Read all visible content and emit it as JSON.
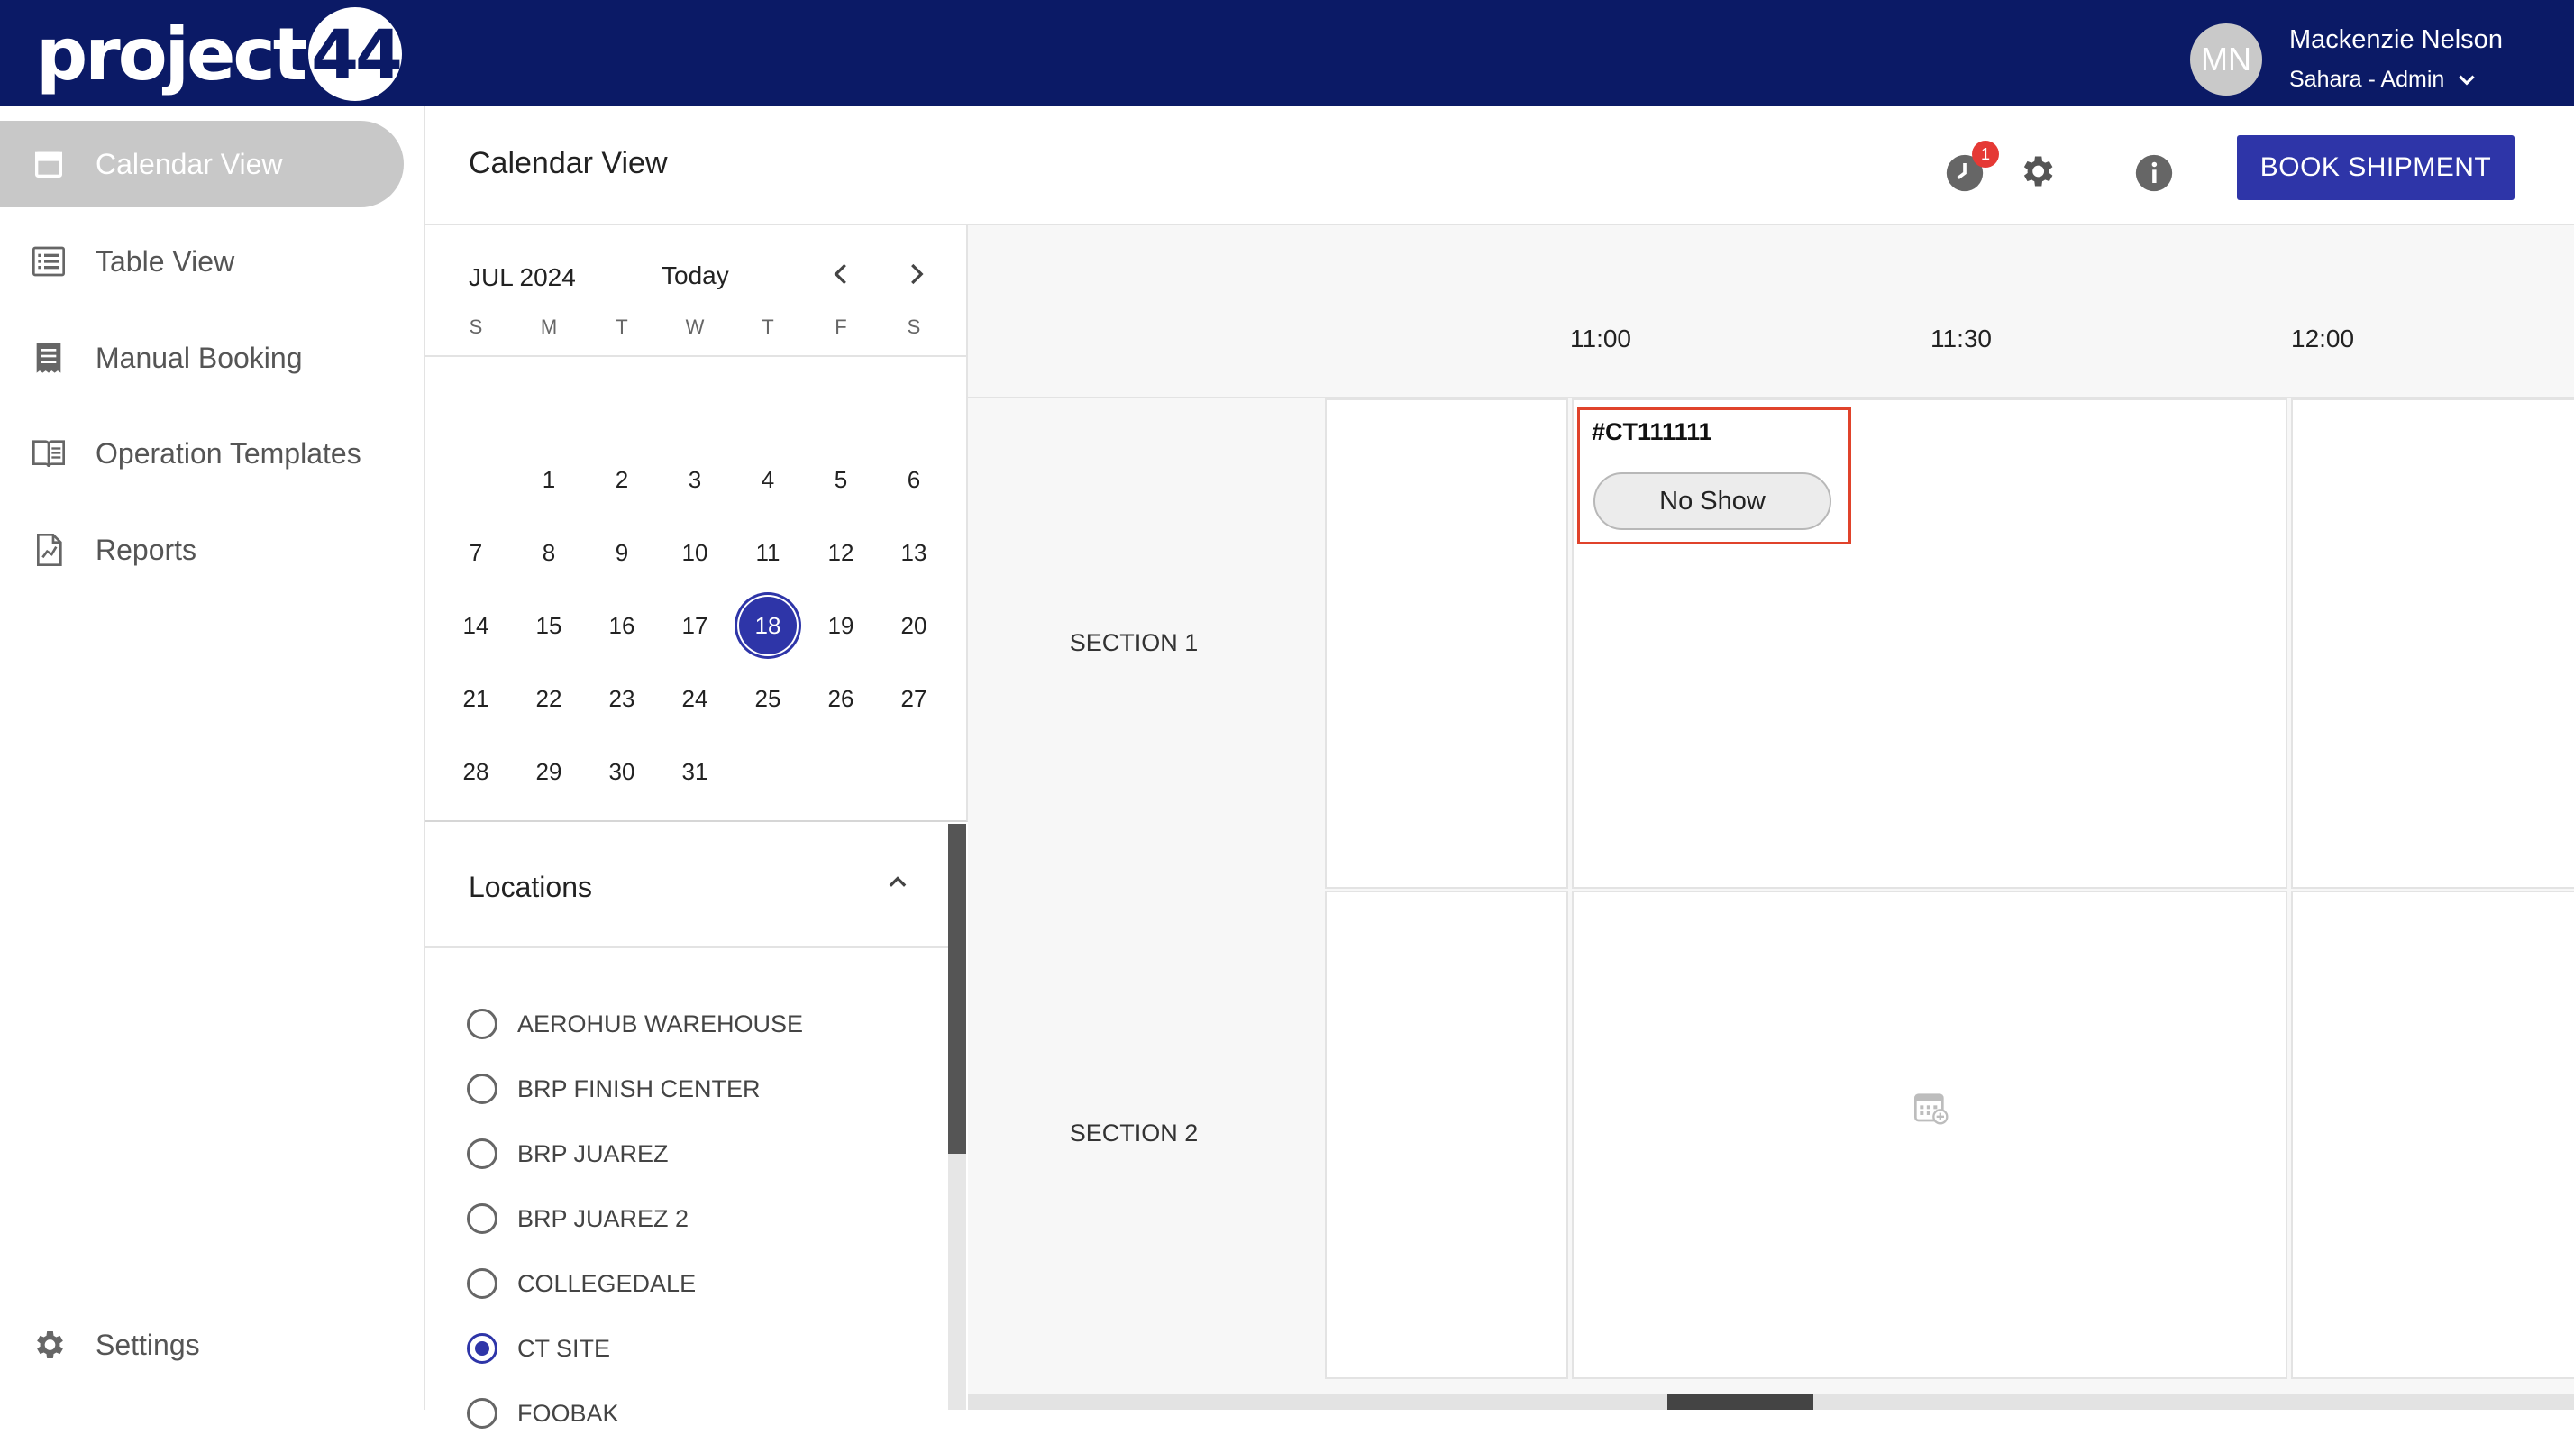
{
  "header": {
    "logo_text": "project",
    "logo_number": "44",
    "user": {
      "initials": "MN",
      "name": "Mackenzie Nelson",
      "org_role": "Sahara - Admin"
    }
  },
  "sidebar": {
    "items": [
      {
        "label": "Calendar View",
        "icon": "calendar-icon",
        "active": true
      },
      {
        "label": "Table View",
        "icon": "list-icon",
        "active": false
      },
      {
        "label": "Manual Booking",
        "icon": "receipt-icon",
        "active": false
      },
      {
        "label": "Operation Templates",
        "icon": "book-icon",
        "active": false
      },
      {
        "label": "Reports",
        "icon": "report-icon",
        "active": false
      }
    ],
    "settings_label": "Settings"
  },
  "page": {
    "title": "Calendar View",
    "notification_count": "1",
    "book_button": "BOOK SHIPMENT"
  },
  "calendar": {
    "month_label": "JUL 2024",
    "today_label": "Today",
    "weekdays": [
      "S",
      "M",
      "T",
      "W",
      "T",
      "F",
      "S"
    ],
    "weeks": [
      [
        "",
        "1",
        "2",
        "3",
        "4",
        "5",
        "6"
      ],
      [
        "7",
        "8",
        "9",
        "10",
        "11",
        "12",
        "13"
      ],
      [
        "14",
        "15",
        "16",
        "17",
        "18",
        "19",
        "20"
      ],
      [
        "21",
        "22",
        "23",
        "24",
        "25",
        "26",
        "27"
      ],
      [
        "28",
        "29",
        "30",
        "31",
        "",
        "",
        ""
      ]
    ],
    "selected_day": "18"
  },
  "locations": {
    "title": "Locations",
    "items": [
      {
        "label": "AEROHUB WAREHOUSE",
        "selected": false
      },
      {
        "label": "BRP FINISH CENTER",
        "selected": false
      },
      {
        "label": "BRP JUAREZ",
        "selected": false
      },
      {
        "label": "BRP JUAREZ 2",
        "selected": false
      },
      {
        "label": "COLLEGEDALE",
        "selected": false
      },
      {
        "label": "CT SITE",
        "selected": true
      },
      {
        "label": "FOOBAK",
        "selected": false
      }
    ]
  },
  "schedule": {
    "times": [
      "11:00",
      "11:30",
      "12:00"
    ],
    "sections": [
      "SECTION 1",
      "SECTION 2"
    ],
    "appointment": {
      "id": "#CT111111",
      "status": "No Show"
    }
  },
  "colors": {
    "header_bg": "#0b1a66",
    "primary": "#2e35a8",
    "highlight": "#e0432b",
    "badge": "#e53935"
  }
}
